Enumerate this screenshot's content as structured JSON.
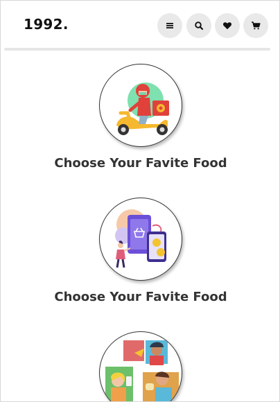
{
  "header": {
    "logo": "1992.",
    "icons": [
      "menu-icon",
      "search-icon",
      "heart-icon",
      "cart-icon"
    ]
  },
  "colors": {
    "icon_button_bg": "#e9e9e9",
    "divider": "#e6e6e6",
    "scooter_yellow": "#f5b82e",
    "rider_red": "#e0413a",
    "phone_purple": "#6c4fd8",
    "coin_gold": "#f4c430"
  },
  "cards": [
    {
      "title": "Choose Your Favite Food",
      "illustration": "delivery-scooter-illustration"
    },
    {
      "title": "Choose Your Favite Food",
      "illustration": "mobile-shopping-illustration"
    },
    {
      "illustration": "people-eating-illustration"
    }
  ]
}
